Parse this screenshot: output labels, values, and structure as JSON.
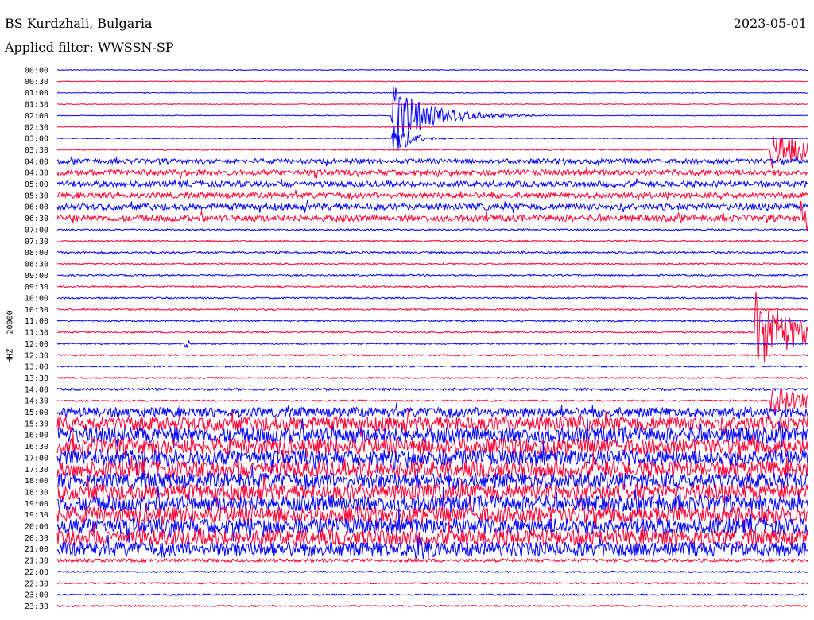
{
  "header": {
    "station": "BS Kurdzhali, Bulgaria",
    "date": "2023-05-01",
    "filter": "Applied filter: WWSSN-SP"
  },
  "chart_data": {
    "type": "line",
    "title": "BS Kurdzhali, Bulgaria",
    "ylabel": "HHZ - 20000",
    "row_interval_minutes": 30,
    "tick_labels": [
      "00:00",
      "00:30",
      "01:00",
      "01:30",
      "02:00",
      "02:30",
      "03:00",
      "03:30",
      "04:00",
      "04:30",
      "05:00",
      "05:30",
      "06:00",
      "06:30",
      "07:00",
      "07:30",
      "08:00",
      "08:30",
      "09:00",
      "09:30",
      "10:00",
      "10:30",
      "11:00",
      "11:30",
      "12:00",
      "12:30",
      "13:00",
      "13:30",
      "14:00",
      "14:30",
      "15:00",
      "15:30",
      "16:00",
      "16:30",
      "17:00",
      "17:30",
      "18:00",
      "18:30",
      "19:00",
      "19:30",
      "20:00",
      "20:30",
      "21:00",
      "21:30",
      "22:00",
      "22:30",
      "23:00",
      "23:30"
    ],
    "trace_colors": [
      "#0000ff",
      "#ff0033"
    ],
    "noise_level": [
      1,
      1,
      1,
      1,
      1,
      1,
      1,
      1.5,
      6,
      7,
      7,
      7,
      8,
      8,
      2,
      2,
      2.5,
      2,
      2,
      2,
      2,
      2,
      2,
      2,
      2,
      2,
      2,
      2,
      3,
      2,
      12,
      18,
      20,
      20,
      20,
      20,
      20,
      20,
      20,
      20,
      20,
      20,
      18,
      4,
      2,
      2,
      2,
      2
    ],
    "events": [
      {
        "row": 4,
        "t": 0.445,
        "amp": 40,
        "decay": 0.05
      },
      {
        "row": 6,
        "t": 0.445,
        "amp": 30,
        "decay": 0.02
      },
      {
        "row": 7,
        "t": 0.95,
        "amp": 25,
        "decay": 0.06
      },
      {
        "row": 13,
        "t": 0.99,
        "amp": 20,
        "decay": 0.02
      },
      {
        "row": 23,
        "t": 0.93,
        "amp": 55,
        "decay": 0.05
      },
      {
        "row": 24,
        "t": 0.17,
        "amp": 10,
        "decay": 0.005
      },
      {
        "row": 29,
        "t": 0.95,
        "amp": 20,
        "decay": 0.06
      },
      {
        "row": 42,
        "t": 0.47,
        "amp": 20,
        "decay": 0.03
      }
    ]
  }
}
